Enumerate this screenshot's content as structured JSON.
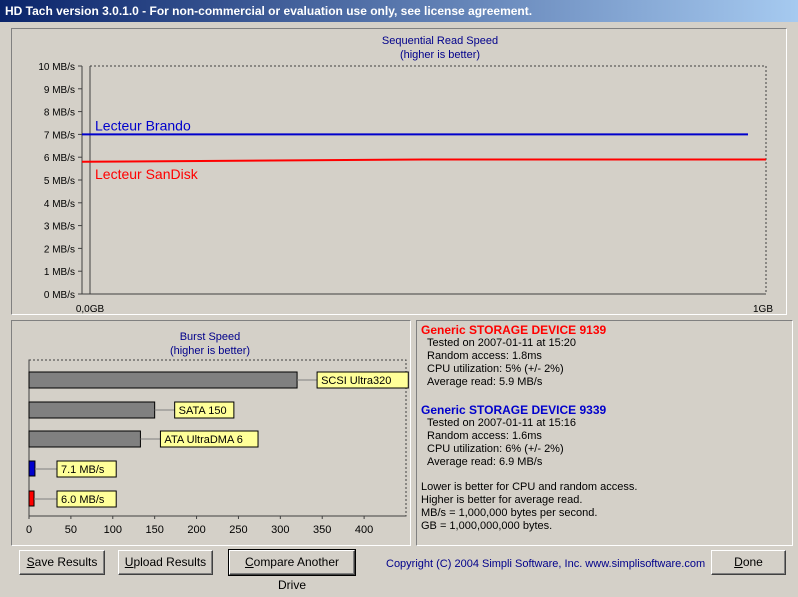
{
  "window": {
    "title": "HD Tach version 3.0.1.0  - For non-commercial or evaluation use only, see license agreement."
  },
  "chart_data": [
    {
      "type": "line",
      "title": "Sequential Read Speed",
      "subtitle": "(higher is better)",
      "ylim": [
        0,
        10
      ],
      "y_tick_labels": [
        "0 MB/s",
        "1 MB/s",
        "2 MB/s",
        "3 MB/s",
        "4 MB/s",
        "5 MB/s",
        "6 MB/s",
        "7 MB/s",
        "8 MB/s",
        "9 MB/s",
        "10 MB/s"
      ],
      "x_tick_labels": [
        "0,0GB",
        "1GB"
      ],
      "grid": true,
      "series": [
        {
          "name": "Lecteur Brando",
          "color": "#0000cc",
          "x": [
            0,
            1
          ],
          "values": [
            7.0,
            7.0
          ]
        },
        {
          "name": "Lecteur SanDisk",
          "color": "#ff0000",
          "x": [
            0,
            0.5,
            1
          ],
          "values": [
            5.8,
            5.9,
            5.9
          ]
        }
      ]
    },
    {
      "type": "bar",
      "orientation": "horizontal",
      "title": "Burst Speed",
      "subtitle": "(higher is better)",
      "xlim": [
        0,
        450
      ],
      "x_tick_labels": [
        "0",
        "50",
        "100",
        "150",
        "200",
        "250",
        "300",
        "350",
        "400"
      ],
      "bars": [
        {
          "label": "SCSI Ultra320",
          "value": 320,
          "color": "#808080"
        },
        {
          "label": "SATA 150",
          "value": 150,
          "color": "#808080"
        },
        {
          "label": "ATA UltraDMA 6",
          "value": 133,
          "color": "#808080"
        },
        {
          "label": "7.1 MB/s",
          "value": 7.1,
          "color": "#0000cc"
        },
        {
          "label": "6.0 MB/s",
          "value": 6.0,
          "color": "#ff0000"
        }
      ]
    }
  ],
  "results": [
    {
      "device": "Generic STORAGE DEVICE 9139",
      "color": "#ff0000",
      "tested": "Tested on 2007-01-11 at 15:20",
      "random": "Random access: 1.8ms",
      "cpu": "CPU utilization: 5% (+/- 2%)",
      "avg": "Average read: 5.9 MB/s"
    },
    {
      "device": "Generic STORAGE DEVICE 9339",
      "color": "#0000cc",
      "tested": "Tested on 2007-01-11 at 15:16",
      "random": "Random access: 1.6ms",
      "cpu": "CPU utilization: 6% (+/- 2%)",
      "avg": "Average read: 6.9 MB/s"
    }
  ],
  "notes": [
    "Lower is better for CPU and random access.",
    "Higher is better for average read.",
    "MB/s = 1,000,000 bytes per second.",
    "GB = 1,000,000,000 bytes."
  ],
  "buttons": {
    "save": {
      "underline": "S",
      "rest": "ave Results"
    },
    "upload": {
      "underline": "U",
      "rest": "pload Results"
    },
    "compare": {
      "underline": "C",
      "rest": "ompare Another Drive"
    },
    "done": {
      "underline": "D",
      "rest": "one"
    }
  },
  "copyright": "Copyright (C) 2004 Simpli Software, Inc. www.simplisoftware.com"
}
